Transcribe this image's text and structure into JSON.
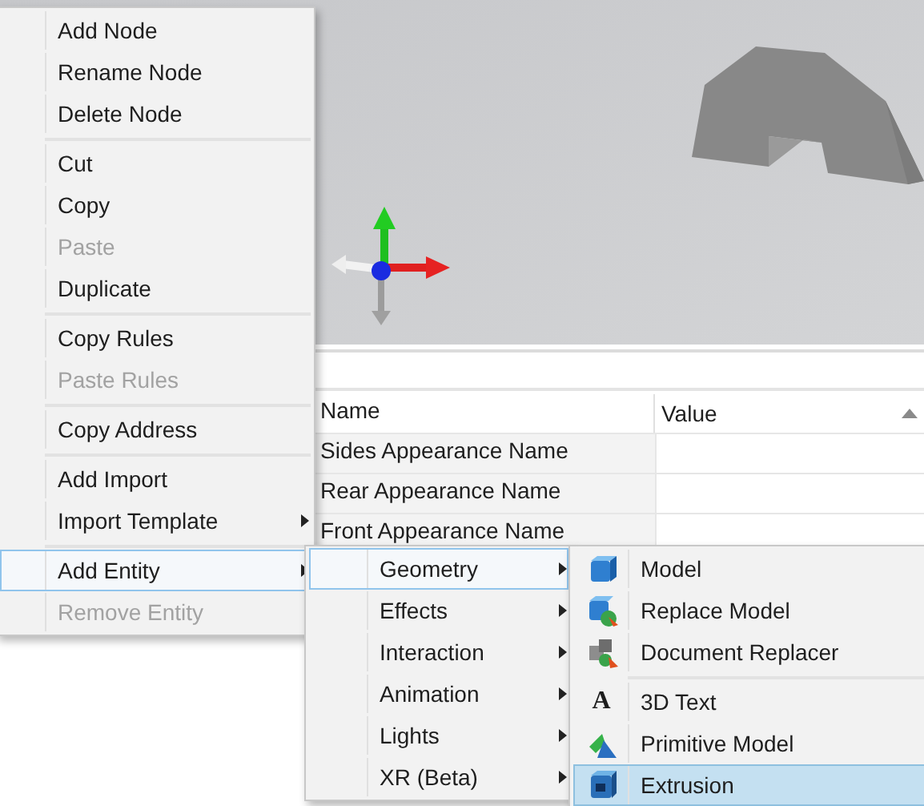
{
  "properties_table": {
    "columns": [
      {
        "label": "Name",
        "sorted": false
      },
      {
        "label": "Value",
        "sorted": true
      }
    ],
    "rows": [
      {
        "name": "Sides Appearance Name"
      },
      {
        "name": "Rear Appearance Name"
      },
      {
        "name": "Front Appearance Name"
      }
    ]
  },
  "context_menu": {
    "groups": [
      {
        "items": [
          {
            "label": "Add Node",
            "disabled": false,
            "submenu": false,
            "selected": false
          },
          {
            "label": "Rename Node",
            "disabled": false,
            "submenu": false,
            "selected": false
          },
          {
            "label": "Delete Node",
            "disabled": false,
            "submenu": false,
            "selected": false
          }
        ]
      },
      {
        "items": [
          {
            "label": "Cut",
            "disabled": false,
            "submenu": false,
            "selected": false
          },
          {
            "label": "Copy",
            "disabled": false,
            "submenu": false,
            "selected": false
          },
          {
            "label": "Paste",
            "disabled": true,
            "submenu": false,
            "selected": false
          },
          {
            "label": "Duplicate",
            "disabled": false,
            "submenu": false,
            "selected": false
          }
        ]
      },
      {
        "items": [
          {
            "label": "Copy Rules",
            "disabled": false,
            "submenu": false,
            "selected": false
          },
          {
            "label": "Paste Rules",
            "disabled": true,
            "submenu": false,
            "selected": false
          }
        ]
      },
      {
        "items": [
          {
            "label": "Copy Address",
            "disabled": false,
            "submenu": false,
            "selected": false
          }
        ]
      },
      {
        "items": [
          {
            "label": "Add Import",
            "disabled": false,
            "submenu": false,
            "selected": false
          },
          {
            "label": "Import Template",
            "disabled": false,
            "submenu": true,
            "selected": false
          }
        ]
      },
      {
        "items": [
          {
            "label": "Add Entity",
            "disabled": false,
            "submenu": true,
            "selected": true
          },
          {
            "label": "Remove Entity",
            "disabled": true,
            "submenu": false,
            "selected": false
          }
        ]
      }
    ]
  },
  "entity_submenu": {
    "groups": [
      {
        "items": [
          {
            "label": "Geometry",
            "disabled": false,
            "submenu": true,
            "selected": true
          },
          {
            "label": "Effects",
            "disabled": false,
            "submenu": true,
            "selected": false
          },
          {
            "label": "Interaction",
            "disabled": false,
            "submenu": true,
            "selected": false
          },
          {
            "label": "Animation",
            "disabled": false,
            "submenu": true,
            "selected": false
          },
          {
            "label": "Lights",
            "disabled": false,
            "submenu": true,
            "selected": false
          },
          {
            "label": "XR (Beta)",
            "disabled": false,
            "submenu": true,
            "selected": false
          }
        ]
      }
    ]
  },
  "geometry_submenu": {
    "groups": [
      {
        "items": [
          {
            "label": "Model",
            "disabled": false,
            "selected": false
          },
          {
            "label": "Replace Model",
            "disabled": false,
            "selected": false
          },
          {
            "label": "Document Replacer",
            "disabled": false,
            "selected": false
          }
        ]
      },
      {
        "items": [
          {
            "label": "3D Text",
            "glyph": "A",
            "disabled": false,
            "selected": false
          },
          {
            "label": "Primitive Model",
            "disabled": false,
            "selected": false
          },
          {
            "label": "Extrusion",
            "disabled": false,
            "selected": true
          }
        ]
      }
    ]
  }
}
